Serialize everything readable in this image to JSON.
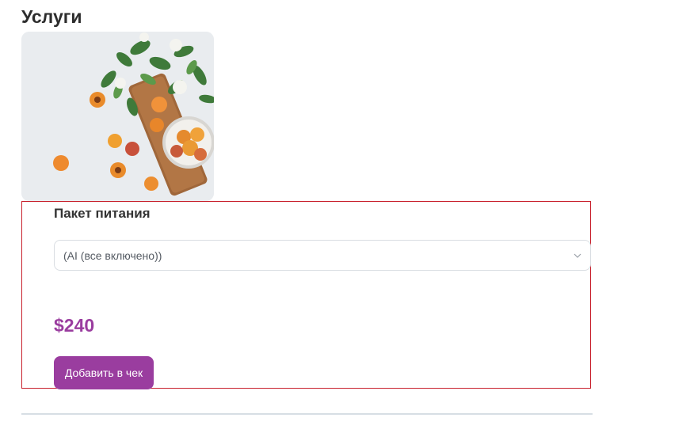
{
  "section": {
    "title": "Услуги"
  },
  "image": {
    "subject": "apricots-with-leaves-and-bowl"
  },
  "service_card": {
    "title": "Пакет питания",
    "select": {
      "selected": "(AI (все включено))"
    },
    "price": "$240",
    "add_button_label": "Добавить в чек"
  },
  "colors": {
    "accent": "#9a3d9f",
    "card_border": "#c8202c",
    "divider": "#d7dee4",
    "select_border": "#d9dde2"
  },
  "icons": {
    "select_chevron": "chevron-down-icon"
  }
}
